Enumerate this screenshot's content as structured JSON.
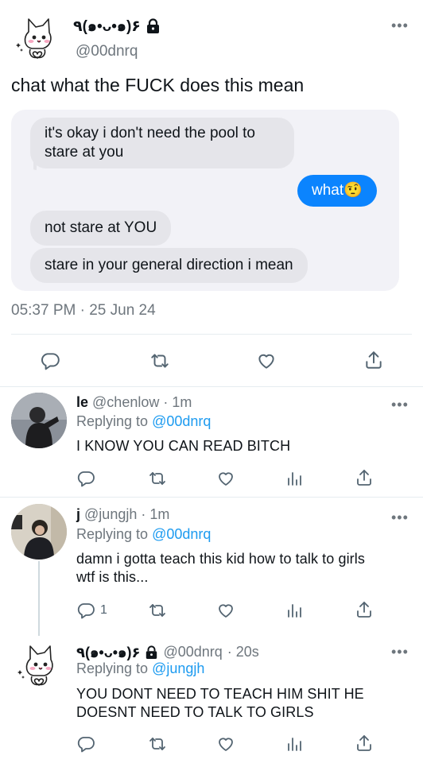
{
  "main_tweet": {
    "display_name": "٩(๑•ᴗ•๑)۶",
    "handle": "@00dnrq",
    "text": "chat what the FUCK does this mean",
    "timestamp": "05:37 PM · 25 Jun 24",
    "more_label": "•••"
  },
  "chat": {
    "messages": [
      {
        "side": "left",
        "lines": [
          "it's okay i don't need the pool to",
          "stare at you"
        ]
      },
      {
        "side": "right",
        "text": "what🤨"
      },
      {
        "side": "left",
        "text": "not stare at YOU"
      },
      {
        "side": "left",
        "text": "stare in your general direction i mean"
      }
    ]
  },
  "replies": [
    {
      "name": "le",
      "handle": "@chenlow",
      "time": "· 1m",
      "replying_prefix": "Replying to",
      "replying_to": "@00dnrq",
      "lines": [
        "I KNOW YOU CAN READ BITCH"
      ],
      "reply_count": ""
    },
    {
      "name": "j",
      "handle": "@jungjh",
      "time": "· 1m",
      "replying_prefix": "Replying to",
      "replying_to": "@00dnrq",
      "lines": [
        "damn i gotta teach this kid how to talk to girls",
        "wtf is this..."
      ],
      "reply_count": "1"
    },
    {
      "name": "٩(๑•ᴗ•๑)۶",
      "handle": "@00dnrq",
      "time": "· 20s",
      "replying_prefix": "Replying to",
      "replying_to": "@jungjh",
      "lines": [
        "YOU DONT NEED TO TEACH HIM SHIT HE",
        "DOESNT NEED TO TALK TO GIRLS"
      ],
      "reply_count": ""
    }
  ],
  "icons": [
    "more-icon",
    "lock-icon",
    "reply-icon",
    "retweet-icon",
    "like-icon",
    "share-icon",
    "analytics-icon"
  ],
  "colors": {
    "accent": "#1d9bf0",
    "imessage_blue": "#0b84fe",
    "bubble_grey": "#e5e5ea",
    "card_bg": "#f2f2f7"
  }
}
